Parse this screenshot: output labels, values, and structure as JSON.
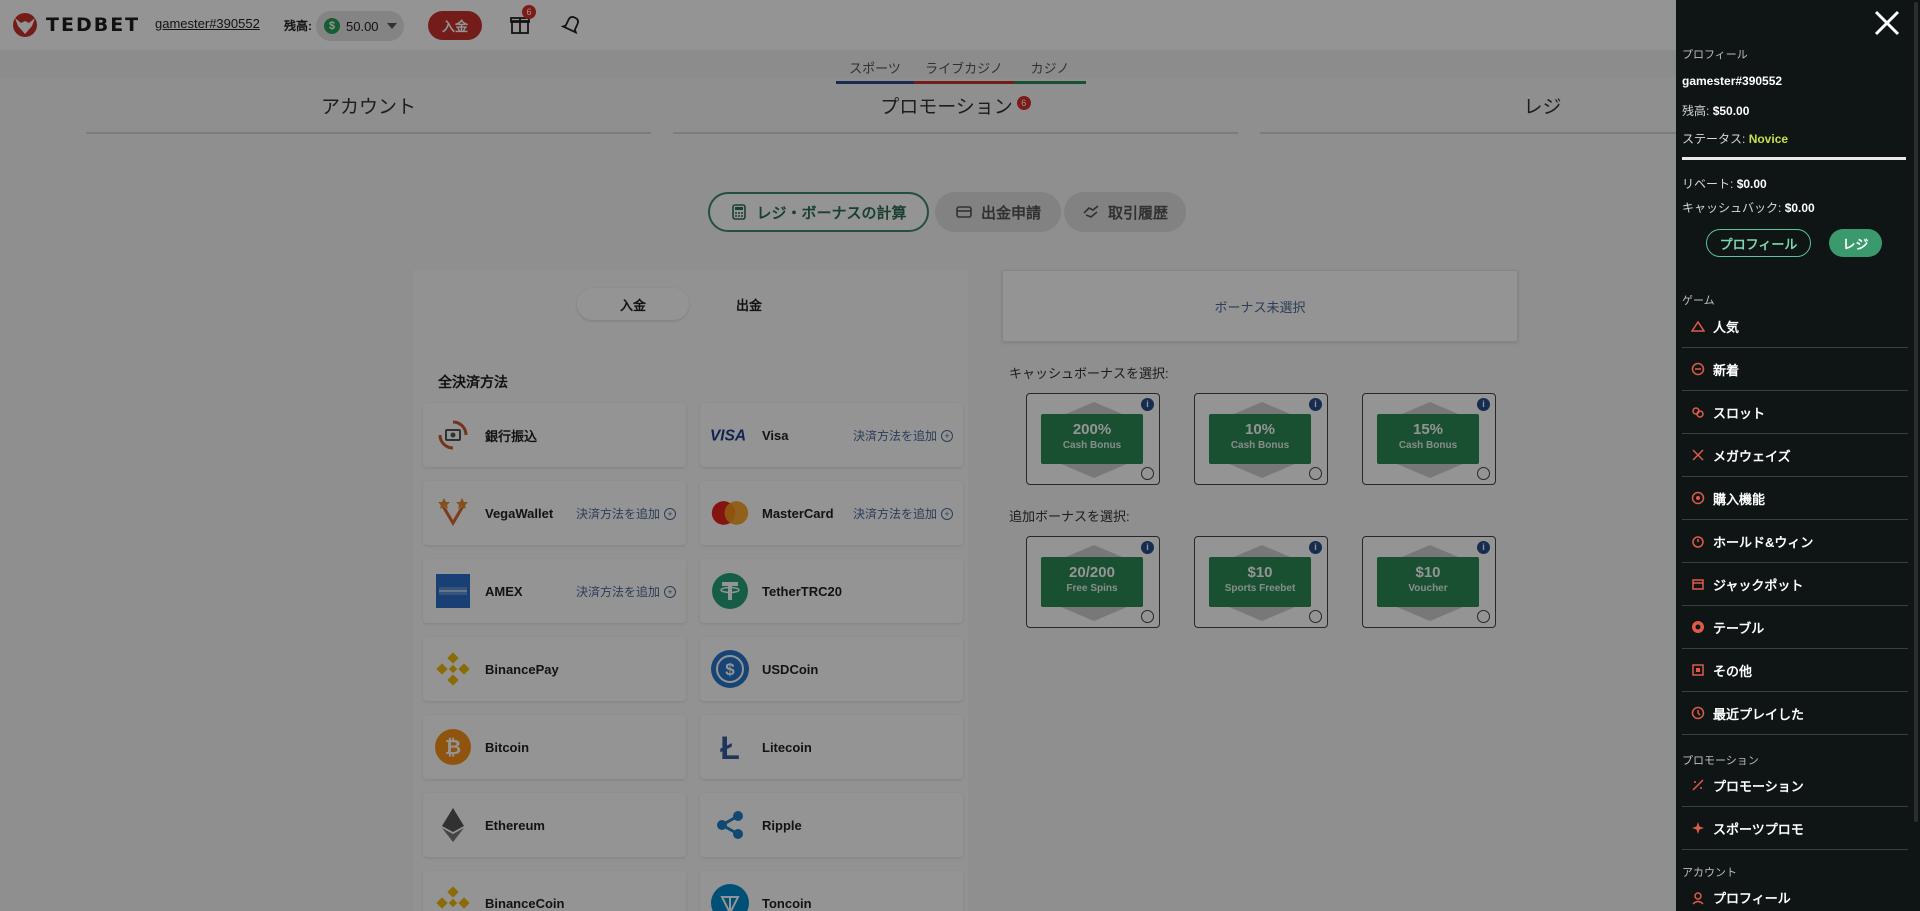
{
  "header": {
    "logo_text": "TEDBET",
    "username": "gamester#390552",
    "balance_label": "残高:",
    "balance_value": "50.00",
    "deposit_label": "入金",
    "gift_badge": "6"
  },
  "subnav": {
    "items": [
      {
        "label": "スポーツ",
        "color": "#2c4a8a"
      },
      {
        "label": "ライブカジノ",
        "color": "#c8312c"
      },
      {
        "label": "カジノ",
        "color": "#2e8b57"
      }
    ]
  },
  "tabs": {
    "account": "アカウント",
    "promotion": "プロモーション",
    "promotion_badge": "6",
    "cashier": "レジ"
  },
  "sub_buttons": {
    "calc": "レジ・ボーナスの計算",
    "withdraw": "出金申請",
    "history": "取引履歴"
  },
  "payment": {
    "deposit": "入金",
    "withdraw": "出金",
    "title": "全決済方法",
    "add_label": "決済方法を追加",
    "methods": [
      {
        "name": "銀行振込",
        "icon": "bank-transfer-icon"
      },
      {
        "name": "Visa",
        "icon": "visa-icon",
        "add": true
      },
      {
        "name": "VegaWallet",
        "icon": "vegawallet-icon",
        "add": true
      },
      {
        "name": "MasterCard",
        "icon": "mastercard-icon",
        "add": true
      },
      {
        "name": "AMEX",
        "icon": "amex-icon",
        "add": true
      },
      {
        "name": "TetherTRC20",
        "icon": "tether-icon"
      },
      {
        "name": "BinancePay",
        "icon": "binance-icon"
      },
      {
        "name": "USDCoin",
        "icon": "usdc-icon"
      },
      {
        "name": "Bitcoin",
        "icon": "bitcoin-icon"
      },
      {
        "name": "Litecoin",
        "icon": "litecoin-icon"
      },
      {
        "name": "Ethereum",
        "icon": "ethereum-icon"
      },
      {
        "name": "Ripple",
        "icon": "ripple-icon"
      },
      {
        "name": "BinanceCoin",
        "icon": "binancecoin-icon"
      },
      {
        "name": "Toncoin",
        "icon": "toncoin-icon"
      }
    ]
  },
  "bonus": {
    "none_selected": "ボーナス未選択",
    "cashback_label": "キャッシュボーナスを選択:",
    "extra_label": "追加ボーナスを選択:",
    "cash_bonuses": [
      {
        "value": "200%",
        "caption": "Cash Bonus"
      },
      {
        "value": "10%",
        "caption": "Cash Bonus"
      },
      {
        "value": "15%",
        "caption": "Cash Bonus"
      }
    ],
    "extra_bonuses": [
      {
        "value": "20/200",
        "caption": "Free Spins"
      },
      {
        "value": "$10",
        "caption": "Sports Freebet"
      },
      {
        "value": "$10",
        "caption": "Voucher"
      }
    ]
  },
  "drawer": {
    "profile_label": "プロフィール",
    "username": "gamester#390552",
    "balance_label": "残高:",
    "balance_value": "$50.00",
    "status_label": "ステータス:",
    "status_value": "Novice",
    "rebate_label": "リベート:",
    "rebate_value": "$0.00",
    "cashback_label": "キャッシュバック:",
    "cashback_value": "$0.00",
    "profile_btn": "プロフィール",
    "cashier_btn": "レジ",
    "games_label": "ゲーム",
    "games": [
      {
        "label": "人気",
        "icon": "popular-icon"
      },
      {
        "label": "新着",
        "icon": "new-icon"
      },
      {
        "label": "スロット",
        "icon": "slots-icon"
      },
      {
        "label": "メガウェイズ",
        "icon": "megaways-icon"
      },
      {
        "label": "購入機能",
        "icon": "buy-feature-icon"
      },
      {
        "label": "ホールド&ウィン",
        "icon": "hold-win-icon"
      },
      {
        "label": "ジャックポット",
        "icon": "jackpot-icon"
      },
      {
        "label": "テーブル",
        "icon": "table-icon"
      },
      {
        "label": "その他",
        "icon": "other-icon"
      },
      {
        "label": "最近プレイした",
        "icon": "recent-icon"
      }
    ],
    "promo_label": "プロモーション",
    "promos": [
      {
        "label": "プロモーション",
        "icon": "promotion-icon"
      },
      {
        "label": "スポーツプロモ",
        "icon": "sports-promo-icon"
      }
    ],
    "account_label": "アカウント",
    "account_items": [
      {
        "label": "プロフィール",
        "icon": "profile-icon"
      }
    ]
  }
}
